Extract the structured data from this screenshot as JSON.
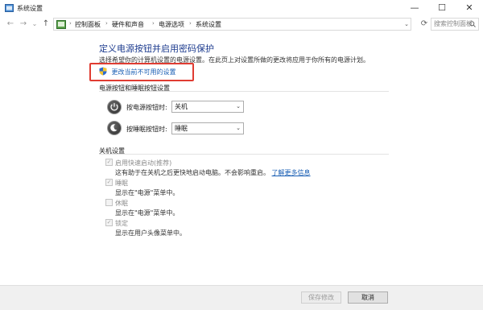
{
  "window": {
    "title": "系统设置",
    "minimize_glyph": "—",
    "maximize_glyph": "☐",
    "close_glyph": "✕"
  },
  "nav": {
    "back_glyph": "←",
    "forward_glyph": "→",
    "recent_glyph": "⌄",
    "up_glyph": "↑",
    "breadcrumbs": [
      "控制面板",
      "硬件和声音",
      "电源选项",
      "系统设置"
    ],
    "separator": "›",
    "dropdown_glyph": "⌄",
    "refresh_glyph": "⟳",
    "search_placeholder": "搜索控制面板"
  },
  "main": {
    "heading": "定义电源按钮并启用密码保护",
    "description": "选择希望你的计算机设置的电源设置。在此页上对设置所做的更改将应用于你所有的电源计划。",
    "change_link": "更改当前不可用的设置",
    "buttons_section": {
      "label": "电源按钮和睡眠按钮设置",
      "rows": [
        {
          "label": "按电源按钮时:",
          "value": "关机"
        },
        {
          "label": "按睡眠按钮时:",
          "value": "睡眠"
        }
      ]
    },
    "shutdown_section": {
      "label": "关机设置",
      "items": [
        {
          "label": "启用快速启动(推荐)",
          "checked": true,
          "desc": "这有助于在关机之后更快地启动电脑。不会影响重启。",
          "link": "了解更多信息"
        },
        {
          "label": "睡眠",
          "checked": true,
          "desc": "显示在\"电源\"菜单中。"
        },
        {
          "label": "休眠",
          "checked": false,
          "desc": "显示在\"电源\"菜单中。"
        },
        {
          "label": "锁定",
          "checked": true,
          "desc": "显示在用户头像菜单中。"
        }
      ]
    }
  },
  "footer": {
    "save_label": "保存修改",
    "cancel_label": "取消"
  },
  "colors": {
    "heading": "#1c3b8e",
    "link": "#1a5fb4",
    "highlight_border": "#e03c32"
  }
}
